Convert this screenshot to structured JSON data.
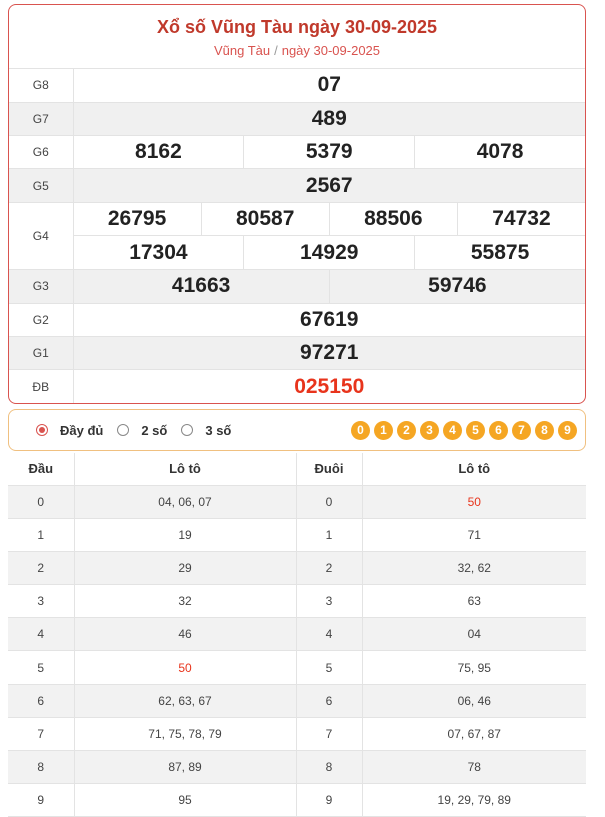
{
  "header": {
    "title": "Xổ số Vũng Tàu ngày 30-09-2025",
    "crumb_place": "Vũng Tàu",
    "crumb_sep": "/",
    "crumb_date": "ngày 30-09-2025"
  },
  "prizes": {
    "g8": {
      "label": "G8",
      "numbers": [
        "07"
      ]
    },
    "g7": {
      "label": "G7",
      "numbers": [
        "489"
      ]
    },
    "g6": {
      "label": "G6",
      "numbers": [
        "8162",
        "5379",
        "4078"
      ]
    },
    "g5": {
      "label": "G5",
      "numbers": [
        "2567"
      ]
    },
    "g4": {
      "label": "G4",
      "numbers": [
        "26795",
        "80587",
        "88506",
        "74732",
        "17304",
        "14929",
        "55875"
      ]
    },
    "g3": {
      "label": "G3",
      "numbers": [
        "41663",
        "59746"
      ]
    },
    "g2": {
      "label": "G2",
      "numbers": [
        "67619"
      ]
    },
    "g1": {
      "label": "G1",
      "numbers": [
        "97271"
      ]
    },
    "db": {
      "label": "ĐB",
      "numbers": [
        "025150"
      ]
    }
  },
  "filter": {
    "options": [
      "Đầy đủ",
      "2 số",
      "3 số"
    ],
    "selected": "Đầy đủ",
    "digits": [
      "0",
      "1",
      "2",
      "3",
      "4",
      "5",
      "6",
      "7",
      "8",
      "9"
    ]
  },
  "loto": {
    "headers": [
      "Đầu",
      "Lô tô",
      "Đuôi",
      "Lô tô"
    ],
    "rows": [
      {
        "dau": "0",
        "dau_loto": "04, 06, 07",
        "duoi": "0",
        "duoi_loto": "50"
      },
      {
        "dau": "1",
        "dau_loto": "19",
        "duoi": "1",
        "duoi_loto": "71"
      },
      {
        "dau": "2",
        "dau_loto": "29",
        "duoi": "2",
        "duoi_loto": "32, 62"
      },
      {
        "dau": "3",
        "dau_loto": "32",
        "duoi": "3",
        "duoi_loto": "63"
      },
      {
        "dau": "4",
        "dau_loto": "46",
        "duoi": "4",
        "duoi_loto": "04"
      },
      {
        "dau": "5",
        "dau_loto": "50",
        "duoi": "5",
        "duoi_loto": "75, 95"
      },
      {
        "dau": "6",
        "dau_loto": "62, 63, 67",
        "duoi": "6",
        "duoi_loto": "06, 46"
      },
      {
        "dau": "7",
        "dau_loto": "71, 75, 78, 79",
        "duoi": "7",
        "duoi_loto": "07, 67, 87"
      },
      {
        "dau": "8",
        "dau_loto": "87, 89",
        "duoi": "8",
        "duoi_loto": "78"
      },
      {
        "dau": "9",
        "dau_loto": "95",
        "duoi": "9",
        "duoi_loto": "19, 29, 79, 89"
      }
    ]
  },
  "colors": {
    "accent": "#c0392b",
    "special": "#e8341c",
    "digit_ball": "#f5a623"
  }
}
